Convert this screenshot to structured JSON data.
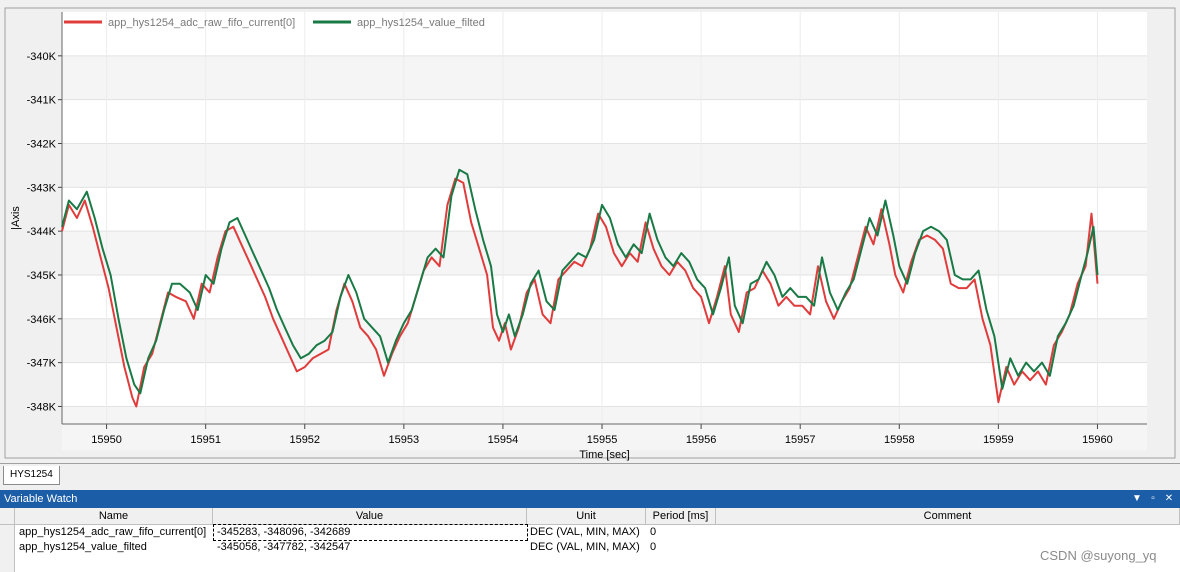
{
  "chart_data": {
    "type": "line",
    "xlabel": "Time [sec]",
    "ylabel": "|Axis",
    "xlim": [
      15949.55,
      15960.5
    ],
    "ylim": [
      -348400,
      -339000
    ],
    "x_ticks": [
      "15950",
      "15951",
      "15952",
      "15953",
      "15954",
      "15955",
      "15956",
      "15957",
      "15958",
      "15959",
      "15960"
    ],
    "y_ticks": [
      "-340K",
      "-341K",
      "-342K",
      "-343K",
      "-344K",
      "-345K",
      "-346K",
      "-347K",
      "-348K"
    ],
    "legend_position": "top-left",
    "series": [
      {
        "name": "app_hys1254_adc_raw_fifo_current[0]",
        "color": "#e03c3c",
        "points": [
          [
            15949.55,
            -344000
          ],
          [
            15949.62,
            -343400
          ],
          [
            15949.7,
            -343700
          ],
          [
            15949.78,
            -343300
          ],
          [
            15949.86,
            -343900
          ],
          [
            15949.94,
            -344600
          ],
          [
            15950.02,
            -345300
          ],
          [
            15950.1,
            -346200
          ],
          [
            15950.18,
            -347100
          ],
          [
            15950.26,
            -347800
          ],
          [
            15950.3,
            -348000
          ],
          [
            15950.38,
            -347100
          ],
          [
            15950.46,
            -346800
          ],
          [
            15950.54,
            -346100
          ],
          [
            15950.62,
            -345400
          ],
          [
            15950.7,
            -345500
          ],
          [
            15950.8,
            -345600
          ],
          [
            15950.88,
            -346000
          ],
          [
            15950.96,
            -345200
          ],
          [
            15951.04,
            -345400
          ],
          [
            15951.12,
            -344600
          ],
          [
            15951.2,
            -344000
          ],
          [
            15951.28,
            -343900
          ],
          [
            15951.36,
            -344300
          ],
          [
            15951.44,
            -344700
          ],
          [
            15951.52,
            -345100
          ],
          [
            15951.6,
            -345500
          ],
          [
            15951.68,
            -346000
          ],
          [
            15951.76,
            -346400
          ],
          [
            15951.84,
            -346800
          ],
          [
            15951.92,
            -347200
          ],
          [
            15952.0,
            -347100
          ],
          [
            15952.08,
            -346900
          ],
          [
            15952.16,
            -346800
          ],
          [
            15952.24,
            -346700
          ],
          [
            15952.32,
            -345800
          ],
          [
            15952.4,
            -345200
          ],
          [
            15952.48,
            -345600
          ],
          [
            15952.56,
            -346200
          ],
          [
            15952.64,
            -346400
          ],
          [
            15952.72,
            -346700
          ],
          [
            15952.8,
            -347300
          ],
          [
            15952.88,
            -346800
          ],
          [
            15952.96,
            -346400
          ],
          [
            15953.04,
            -346100
          ],
          [
            15953.12,
            -345500
          ],
          [
            15953.2,
            -344900
          ],
          [
            15953.28,
            -344600
          ],
          [
            15953.36,
            -344800
          ],
          [
            15953.44,
            -343400
          ],
          [
            15953.52,
            -342800
          ],
          [
            15953.6,
            -342900
          ],
          [
            15953.68,
            -343800
          ],
          [
            15953.76,
            -344400
          ],
          [
            15953.84,
            -345000
          ],
          [
            15953.9,
            -346200
          ],
          [
            15953.96,
            -346500
          ],
          [
            15954.02,
            -346100
          ],
          [
            15954.08,
            -346700
          ],
          [
            15954.16,
            -346200
          ],
          [
            15954.24,
            -345400
          ],
          [
            15954.32,
            -345100
          ],
          [
            15954.4,
            -345900
          ],
          [
            15954.48,
            -346100
          ],
          [
            15954.56,
            -345100
          ],
          [
            15954.64,
            -344900
          ],
          [
            15954.72,
            -344700
          ],
          [
            15954.8,
            -344800
          ],
          [
            15954.88,
            -344400
          ],
          [
            15954.96,
            -343600
          ],
          [
            15955.04,
            -343900
          ],
          [
            15955.12,
            -344500
          ],
          [
            15955.2,
            -344800
          ],
          [
            15955.28,
            -344500
          ],
          [
            15955.36,
            -344700
          ],
          [
            15955.44,
            -343800
          ],
          [
            15955.52,
            -344400
          ],
          [
            15955.6,
            -344800
          ],
          [
            15955.68,
            -345000
          ],
          [
            15955.76,
            -344700
          ],
          [
            15955.84,
            -344900
          ],
          [
            15955.92,
            -345300
          ],
          [
            15956.0,
            -345500
          ],
          [
            15956.08,
            -346100
          ],
          [
            15956.16,
            -345500
          ],
          [
            15956.24,
            -344800
          ],
          [
            15956.3,
            -345900
          ],
          [
            15956.38,
            -346300
          ],
          [
            15956.46,
            -345400
          ],
          [
            15956.54,
            -345300
          ],
          [
            15956.62,
            -344900
          ],
          [
            15956.7,
            -345200
          ],
          [
            15956.78,
            -345700
          ],
          [
            15956.86,
            -345500
          ],
          [
            15956.94,
            -345700
          ],
          [
            15957.02,
            -345700
          ],
          [
            15957.1,
            -345900
          ],
          [
            15957.18,
            -344800
          ],
          [
            15957.26,
            -345600
          ],
          [
            15957.34,
            -346000
          ],
          [
            15957.42,
            -345600
          ],
          [
            15957.5,
            -345300
          ],
          [
            15957.58,
            -344600
          ],
          [
            15957.66,
            -343900
          ],
          [
            15957.74,
            -344300
          ],
          [
            15957.82,
            -343500
          ],
          [
            15957.9,
            -344300
          ],
          [
            15957.96,
            -345000
          ],
          [
            15958.04,
            -345400
          ],
          [
            15958.12,
            -344700
          ],
          [
            15958.2,
            -344200
          ],
          [
            15958.28,
            -344100
          ],
          [
            15958.36,
            -344200
          ],
          [
            15958.44,
            -344400
          ],
          [
            15958.52,
            -345200
          ],
          [
            15958.6,
            -345300
          ],
          [
            15958.68,
            -345300
          ],
          [
            15958.76,
            -345100
          ],
          [
            15958.84,
            -346000
          ],
          [
            15958.92,
            -346600
          ],
          [
            15959.0,
            -347900
          ],
          [
            15959.08,
            -347100
          ],
          [
            15959.16,
            -347500
          ],
          [
            15959.24,
            -347200
          ],
          [
            15959.32,
            -347400
          ],
          [
            15959.4,
            -347200
          ],
          [
            15959.48,
            -347500
          ],
          [
            15959.56,
            -346600
          ],
          [
            15959.64,
            -346300
          ],
          [
            15959.72,
            -345900
          ],
          [
            15959.8,
            -345200
          ],
          [
            15959.88,
            -344800
          ],
          [
            15959.94,
            -343600
          ],
          [
            15960.0,
            -345200
          ]
        ]
      },
      {
        "name": "app_hys1254_value_filted",
        "color": "#1a7a46",
        "points": [
          [
            15949.55,
            -343900
          ],
          [
            15949.62,
            -343300
          ],
          [
            15949.7,
            -343500
          ],
          [
            15949.8,
            -343100
          ],
          [
            15949.88,
            -343700
          ],
          [
            15949.96,
            -344400
          ],
          [
            15950.04,
            -345000
          ],
          [
            15950.12,
            -346000
          ],
          [
            15950.2,
            -346900
          ],
          [
            15950.28,
            -347500
          ],
          [
            15950.34,
            -347700
          ],
          [
            15950.42,
            -346900
          ],
          [
            15950.5,
            -346500
          ],
          [
            15950.58,
            -345800
          ],
          [
            15950.66,
            -345200
          ],
          [
            15950.74,
            -345200
          ],
          [
            15950.84,
            -345400
          ],
          [
            15950.92,
            -345800
          ],
          [
            15951.0,
            -345000
          ],
          [
            15951.08,
            -345200
          ],
          [
            15951.16,
            -344400
          ],
          [
            15951.24,
            -343800
          ],
          [
            15951.32,
            -343700
          ],
          [
            15951.4,
            -344100
          ],
          [
            15951.48,
            -344500
          ],
          [
            15951.56,
            -344900
          ],
          [
            15951.64,
            -345300
          ],
          [
            15951.72,
            -345800
          ],
          [
            15951.8,
            -346200
          ],
          [
            15951.88,
            -346600
          ],
          [
            15951.96,
            -346900
          ],
          [
            15952.04,
            -346800
          ],
          [
            15952.12,
            -346600
          ],
          [
            15952.2,
            -346500
          ],
          [
            15952.28,
            -346300
          ],
          [
            15952.36,
            -345500
          ],
          [
            15952.44,
            -345000
          ],
          [
            15952.52,
            -345400
          ],
          [
            15952.6,
            -346000
          ],
          [
            15952.68,
            -346200
          ],
          [
            15952.76,
            -346400
          ],
          [
            15952.84,
            -347000
          ],
          [
            15952.92,
            -346500
          ],
          [
            15953.0,
            -346100
          ],
          [
            15953.08,
            -345800
          ],
          [
            15953.16,
            -345200
          ],
          [
            15953.24,
            -344600
          ],
          [
            15953.32,
            -344400
          ],
          [
            15953.4,
            -344600
          ],
          [
            15953.48,
            -343200
          ],
          [
            15953.56,
            -342600
          ],
          [
            15953.64,
            -342700
          ],
          [
            15953.72,
            -343500
          ],
          [
            15953.8,
            -344200
          ],
          [
            15953.88,
            -344800
          ],
          [
            15953.94,
            -345900
          ],
          [
            15954.0,
            -346300
          ],
          [
            15954.06,
            -345900
          ],
          [
            15954.12,
            -346400
          ],
          [
            15954.2,
            -345900
          ],
          [
            15954.28,
            -345200
          ],
          [
            15954.36,
            -344900
          ],
          [
            15954.44,
            -345600
          ],
          [
            15954.52,
            -345800
          ],
          [
            15954.6,
            -344900
          ],
          [
            15954.68,
            -344700
          ],
          [
            15954.76,
            -344500
          ],
          [
            15954.84,
            -344600
          ],
          [
            15954.92,
            -344200
          ],
          [
            15955.0,
            -343400
          ],
          [
            15955.08,
            -343700
          ],
          [
            15955.16,
            -344300
          ],
          [
            15955.24,
            -344600
          ],
          [
            15955.32,
            -344300
          ],
          [
            15955.4,
            -344500
          ],
          [
            15955.48,
            -343600
          ],
          [
            15955.56,
            -344200
          ],
          [
            15955.64,
            -344600
          ],
          [
            15955.72,
            -344800
          ],
          [
            15955.8,
            -344500
          ],
          [
            15955.88,
            -344700
          ],
          [
            15955.96,
            -345100
          ],
          [
            15956.04,
            -345300
          ],
          [
            15956.12,
            -345900
          ],
          [
            15956.2,
            -345300
          ],
          [
            15956.28,
            -344600
          ],
          [
            15956.34,
            -345700
          ],
          [
            15956.42,
            -346100
          ],
          [
            15956.5,
            -345200
          ],
          [
            15956.58,
            -345100
          ],
          [
            15956.66,
            -344700
          ],
          [
            15956.74,
            -345000
          ],
          [
            15956.82,
            -345500
          ],
          [
            15956.9,
            -345300
          ],
          [
            15956.98,
            -345500
          ],
          [
            15957.06,
            -345500
          ],
          [
            15957.14,
            -345700
          ],
          [
            15957.22,
            -344600
          ],
          [
            15957.3,
            -345400
          ],
          [
            15957.38,
            -345800
          ],
          [
            15957.46,
            -345400
          ],
          [
            15957.54,
            -345100
          ],
          [
            15957.62,
            -344400
          ],
          [
            15957.7,
            -343700
          ],
          [
            15957.78,
            -344100
          ],
          [
            15957.86,
            -343300
          ],
          [
            15957.94,
            -344100
          ],
          [
            15958.0,
            -344800
          ],
          [
            15958.08,
            -345200
          ],
          [
            15958.16,
            -344500
          ],
          [
            15958.24,
            -344000
          ],
          [
            15958.32,
            -343900
          ],
          [
            15958.4,
            -344000
          ],
          [
            15958.48,
            -344200
          ],
          [
            15958.56,
            -345000
          ],
          [
            15958.64,
            -345100
          ],
          [
            15958.72,
            -345100
          ],
          [
            15958.8,
            -344900
          ],
          [
            15958.88,
            -345800
          ],
          [
            15958.96,
            -346400
          ],
          [
            15959.04,
            -347600
          ],
          [
            15959.12,
            -346900
          ],
          [
            15959.2,
            -347300
          ],
          [
            15959.28,
            -347000
          ],
          [
            15959.36,
            -347200
          ],
          [
            15959.44,
            -347000
          ],
          [
            15959.52,
            -347300
          ],
          [
            15959.6,
            -346400
          ],
          [
            15959.68,
            -346100
          ],
          [
            15959.76,
            -345700
          ],
          [
            15959.84,
            -345000
          ],
          [
            15959.9,
            -344500
          ],
          [
            15959.96,
            -343900
          ],
          [
            15960.0,
            -345000
          ]
        ]
      }
    ]
  },
  "tabs": [
    {
      "label": "HYS1254"
    }
  ],
  "variable_watch": {
    "title": "Variable Watch",
    "controls": [
      "▼",
      "▫",
      "✕"
    ],
    "columns": [
      "Name",
      "Value",
      "Unit",
      "Period [ms]",
      "Comment"
    ],
    "rows": [
      {
        "name": "app_hys1254_adc_raw_fifo_current[0]",
        "value": "-345283, -348096, -342689",
        "unit": "DEC (VAL, MIN, MAX)",
        "period": "0",
        "comment": ""
      },
      {
        "name": "app_hys1254_value_filted",
        "value": "-345058, -347782, -342547",
        "unit": "DEC (VAL, MIN, MAX)",
        "period": "0",
        "comment": ""
      }
    ]
  },
  "watermark": "CSDN @suyong_yq"
}
